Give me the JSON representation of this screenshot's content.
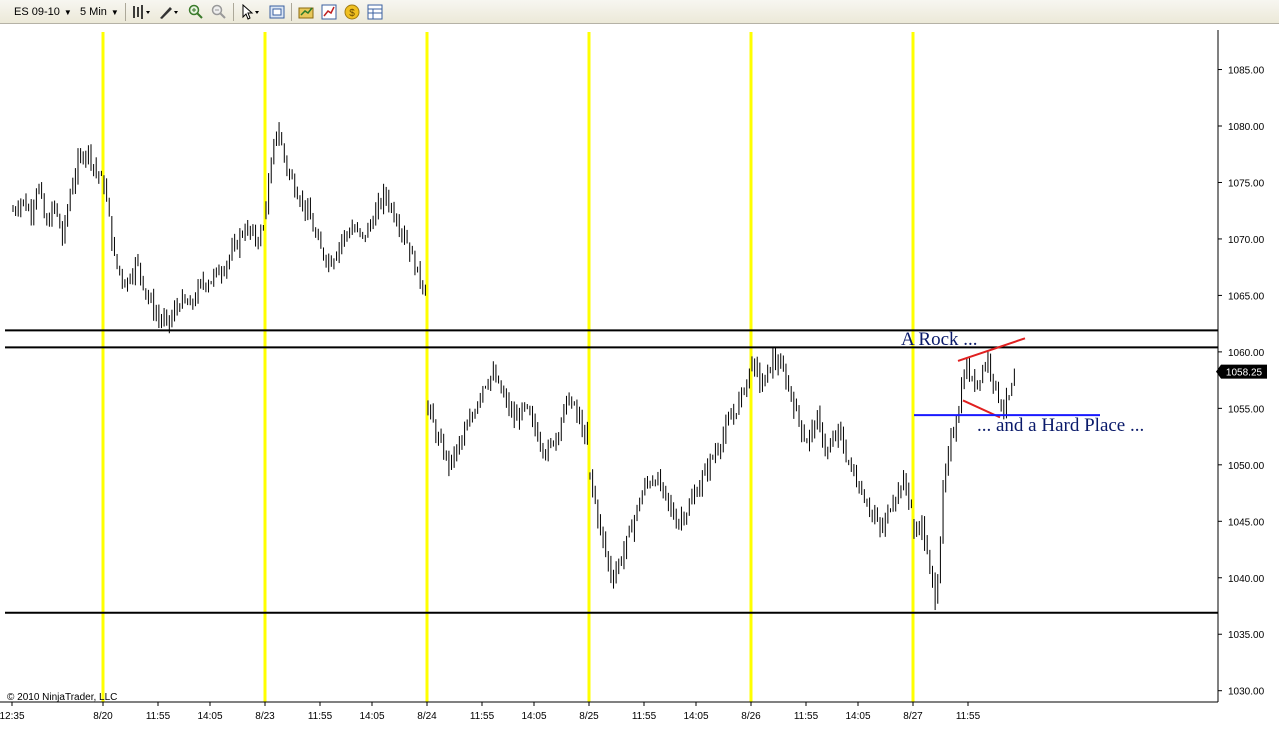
{
  "toolbar": {
    "instrument": "ES 09-10",
    "interval": "5 Min",
    "icons": [
      "bar-style-icon",
      "drawing-tool-icon",
      "zoom-in-icon",
      "zoom-out-icon",
      "pointer-icon",
      "properties-icon",
      "data-series-icon",
      "strategy-icon",
      "dollar-icon",
      "data-box-icon"
    ]
  },
  "colors": {
    "session_divider": "#ffff00",
    "bars": "#000000",
    "rock_lines": "#e02020",
    "hard_place_line": "#1a1aff",
    "horizontal_levels": "#000000",
    "price_marker_bg": "#000000"
  },
  "copyright": "© 2010 NinjaTrader, LLC",
  "annotations": {
    "rock": "A Rock ...",
    "hard_place": "... and a Hard Place ..."
  },
  "chart_data": {
    "type": "ohlc",
    "ylim": [
      1029,
      1088.5
    ],
    "y_ticks": [
      1030.0,
      1035.0,
      1040.0,
      1045.0,
      1050.0,
      1055.0,
      1060.0,
      1065.0,
      1070.0,
      1075.0,
      1080.0,
      1085.0
    ],
    "y_tick_labels": [
      "1030.00",
      "1035.00",
      "1040.00",
      "1045.00",
      "1050.00",
      "1055.00",
      "1060.00",
      "1065.00",
      "1070.00",
      "1075.00",
      "1080.00",
      "1085.00"
    ],
    "x_tick_labels": [
      "12:35",
      "8/20",
      "11:55",
      "14:05",
      "8/23",
      "11:55",
      "14:05",
      "8/24",
      "11:55",
      "14:05",
      "8/25",
      "11:55",
      "14:05",
      "8/26",
      "11:55",
      "14:05",
      "8/27",
      "11:55"
    ],
    "current_price": "1058.25",
    "horizontal_levels": [
      1061.9,
      1060.4,
      1036.9
    ],
    "rock_line": {
      "start": 1059.2,
      "end": 1061.2
    },
    "hard_place_level": 1054.4,
    "hard_place_support": {
      "start": 1055.7,
      "end": 1054.2
    },
    "series": [
      {
        "session": "8/19",
        "segments": [
          [
            1072.5,
            1073.5
          ],
          [
            1073.5,
            1072.5
          ],
          [
            1072,
            1075
          ],
          [
            1075,
            1071
          ],
          [
            1071,
            1073
          ],
          [
            1073,
            1070
          ],
          [
            1070,
            1074.5
          ],
          [
            1074.5,
            1077
          ],
          [
            1077,
            1078
          ],
          [
            1078,
            1076
          ],
          [
            1076,
            1075
          ]
        ]
      },
      {
        "session": "8/20",
        "segments": [
          [
            1075,
            1068
          ],
          [
            1068,
            1066
          ],
          [
            1066,
            1068
          ],
          [
            1068,
            1065
          ],
          [
            1065,
            1063
          ],
          [
            1063,
            1062.5
          ],
          [
            1062.5,
            1064.5
          ],
          [
            1064.5,
            1064
          ],
          [
            1064,
            1066
          ],
          [
            1066,
            1066.5
          ],
          [
            1066.5,
            1067.5
          ],
          [
            1067.5,
            1069
          ],
          [
            1069,
            1071
          ],
          [
            1071,
            1070
          ],
          [
            1070,
            1071
          ]
        ]
      },
      {
        "session": "8/23",
        "segments": [
          [
            1073,
            1080
          ],
          [
            1080,
            1076
          ],
          [
            1076,
            1074
          ],
          [
            1074,
            1072
          ],
          [
            1072,
            1069
          ],
          [
            1069,
            1068
          ],
          [
            1068,
            1070
          ],
          [
            1070,
            1071
          ],
          [
            1071,
            1070
          ],
          [
            1070,
            1072
          ],
          [
            1072,
            1074
          ],
          [
            1074,
            1072
          ],
          [
            1072,
            1070
          ],
          [
            1070,
            1067
          ],
          [
            1067,
            1065
          ]
        ]
      },
      {
        "session": "8/24",
        "segments": [
          [
            1055,
            1052
          ],
          [
            1052,
            1050
          ],
          [
            1050,
            1052
          ],
          [
            1052,
            1054
          ],
          [
            1054,
            1057
          ],
          [
            1057,
            1058
          ],
          [
            1058,
            1056
          ],
          [
            1056,
            1054
          ],
          [
            1054,
            1055
          ],
          [
            1055,
            1053
          ],
          [
            1053,
            1051
          ],
          [
            1051,
            1053
          ],
          [
            1053,
            1056
          ],
          [
            1056,
            1054
          ],
          [
            1054,
            1051
          ]
        ]
      },
      {
        "session": "8/25",
        "segments": [
          [
            1049,
            1044
          ],
          [
            1044,
            1040
          ],
          [
            1040,
            1042
          ],
          [
            1042,
            1045
          ],
          [
            1045,
            1048
          ],
          [
            1048,
            1049
          ],
          [
            1049,
            1047
          ],
          [
            1047,
            1045
          ],
          [
            1045,
            1046
          ],
          [
            1046,
            1048
          ],
          [
            1048,
            1050
          ],
          [
            1050,
            1052
          ],
          [
            1052,
            1054
          ],
          [
            1054,
            1056
          ],
          [
            1056,
            1059
          ]
        ]
      },
      {
        "session": "8/26",
        "segments": [
          [
            1059,
            1057
          ],
          [
            1057,
            1059.5
          ],
          [
            1059.5,
            1058
          ],
          [
            1058,
            1055
          ],
          [
            1055,
            1052
          ],
          [
            1052,
            1054
          ],
          [
            1054,
            1051
          ],
          [
            1051,
            1053
          ],
          [
            1053,
            1050
          ],
          [
            1050,
            1048
          ],
          [
            1048,
            1046
          ],
          [
            1046,
            1044
          ],
          [
            1044,
            1047
          ],
          [
            1047,
            1048.5
          ],
          [
            1048.5,
            1046
          ]
        ]
      },
      {
        "session": "8/27",
        "segments": [
          [
            1044,
            1045
          ],
          [
            1045,
            1041
          ],
          [
            1041,
            1038
          ],
          [
            1038,
            1048
          ],
          [
            1048,
            1052
          ],
          [
            1052,
            1055
          ],
          [
            1055,
            1059
          ],
          [
            1059,
            1057
          ],
          [
            1057,
            1058
          ],
          [
            1058,
            1059.5
          ],
          [
            1059.5,
            1057
          ],
          [
            1057,
            1055
          ],
          [
            1055,
            1056
          ],
          [
            1056,
            1058.5
          ]
        ]
      }
    ]
  }
}
